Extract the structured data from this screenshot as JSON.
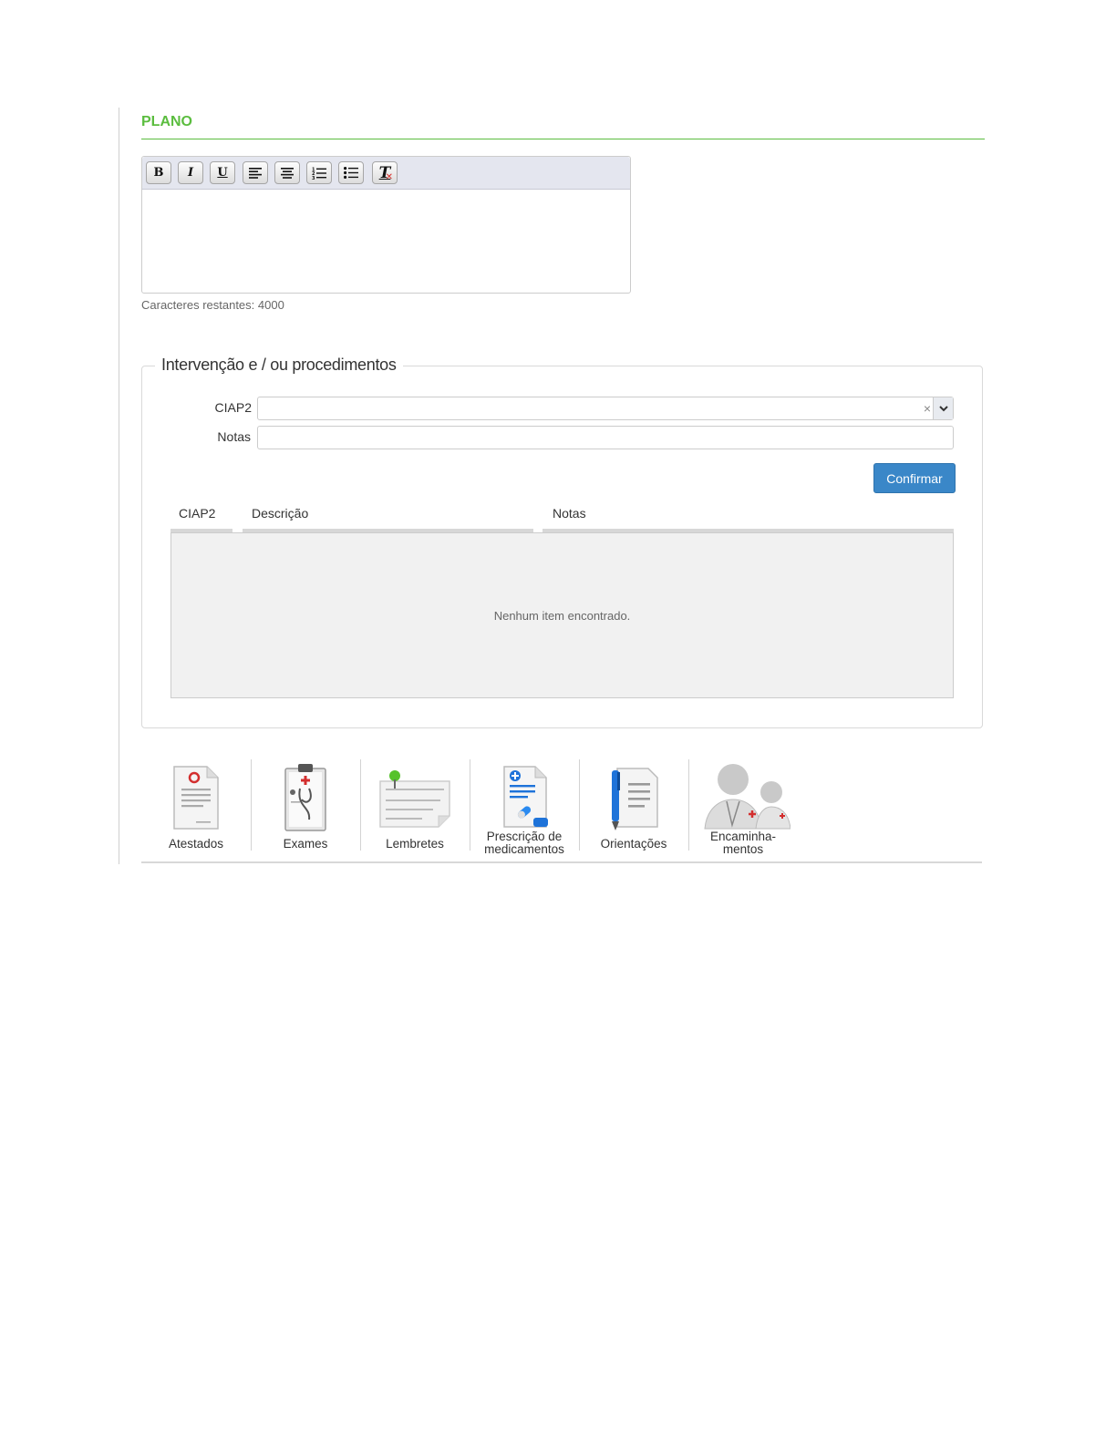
{
  "section": {
    "title": "PLANO"
  },
  "editor": {
    "toolbar": [
      {
        "name": "bold-button",
        "label": "B",
        "icon": "bold-icon"
      },
      {
        "name": "italic-button",
        "label": "I",
        "icon": "italic-icon"
      },
      {
        "name": "underline-button",
        "label": "U",
        "icon": "underline-icon"
      },
      {
        "name": "align-left-button",
        "label": "",
        "icon": "align-left-icon"
      },
      {
        "name": "align-center-button",
        "label": "",
        "icon": "align-center-icon"
      },
      {
        "name": "ordered-list-button",
        "label": "",
        "icon": "ordered-list-icon"
      },
      {
        "name": "unordered-list-button",
        "label": "",
        "icon": "unordered-list-icon"
      },
      {
        "name": "remove-format-button",
        "label": "T",
        "icon": "remove-format-icon"
      }
    ],
    "char_count": "Caracteres restantes: 4000"
  },
  "interventions": {
    "legend": "Intervenção e / ou procedimentos",
    "ciap2_label": "CIAP2",
    "notes_label": "Notas",
    "clear_glyph": "×",
    "confirm_label": "Confirmar",
    "table": {
      "headers": [
        "CIAP2",
        "Descrição",
        "Notas"
      ],
      "empty_message": "Nenhum item encontrado."
    }
  },
  "shortcuts": [
    {
      "label": "Atestados",
      "icon": "medical-certificate-icon"
    },
    {
      "label": "Exames",
      "icon": "clipboard-stethoscope-icon"
    },
    {
      "label": "Lembretes",
      "icon": "pinned-note-icon"
    },
    {
      "label": "Prescrição de medicamentos",
      "line1": "Prescrição de",
      "line2": "medicamentos",
      "icon": "prescription-icon"
    },
    {
      "label": "Orientações",
      "icon": "document-pen-icon"
    },
    {
      "label": "Encaminhamentos",
      "line1": "Encaminha-",
      "line2": "mentos",
      "icon": "doctors-referral-icon"
    }
  ],
  "colors": {
    "accent_green": "#5bbd3f",
    "button_blue": "#3a87c8"
  }
}
